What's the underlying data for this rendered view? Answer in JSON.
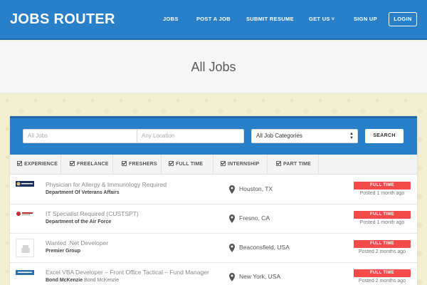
{
  "header": {
    "brand": "JOBS ROUTER",
    "nav": [
      {
        "label": "JOBS",
        "name": "nav-jobs"
      },
      {
        "label": "POST A JOB",
        "name": "nav-post-a-job"
      },
      {
        "label": "SUBMIT RESUME",
        "name": "nav-submit-resume"
      },
      {
        "label": "GET US",
        "name": "nav-get-us"
      },
      {
        "label": "SIGN UP",
        "name": "nav-sign-up"
      }
    ],
    "login": "LOGIN"
  },
  "page_title": "All Jobs",
  "search": {
    "keyword_placeholder": "All Jobs",
    "location_placeholder": "Any Location",
    "category_selected": "All Job Categories",
    "button": "SEARCH"
  },
  "filters": [
    "EXPERIENCE",
    "FREELANCE",
    "FRESHERS",
    "FULL TIME",
    "INTERNSHIP",
    "PART TIME"
  ],
  "jobs": [
    {
      "title": "Physician for Allergy & Immunology Required",
      "company": "Department Of Veterans Affairs",
      "company_sub": "",
      "location": "Houston, TX",
      "type": "FULL TIME",
      "posted": "Posted 1 month ago"
    },
    {
      "title": "IT Specialist Required (CUSTSPT)",
      "company": "Department of the Air Force",
      "company_sub": "",
      "location": "Fresno, CA",
      "type": "FULL TIME",
      "posted": "Posted 1 month ago"
    },
    {
      "title": "Wanted .Net Developer",
      "company": "Premier Group",
      "company_sub": "",
      "location": "Beaconsfield, USA",
      "type": "FULL TIME",
      "posted": "Posted 2 months ago"
    },
    {
      "title": "Excel VBA Developer – Front Office Tactical – Fund Manager",
      "company": "Bond McKenzie",
      "company_sub": "Bond McKenzie",
      "location": "New York, USA",
      "type": "FULL TIME",
      "posted": "Posted 2 months ago"
    }
  ],
  "colors": {
    "primary": "#2a7fc9",
    "badge": "#f34a4a"
  }
}
